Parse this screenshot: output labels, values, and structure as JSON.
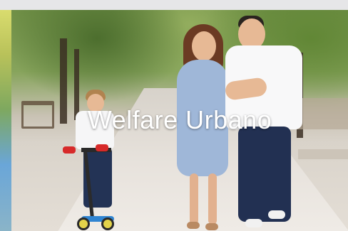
{
  "hero": {
    "title": "Welfare Urbano"
  }
}
